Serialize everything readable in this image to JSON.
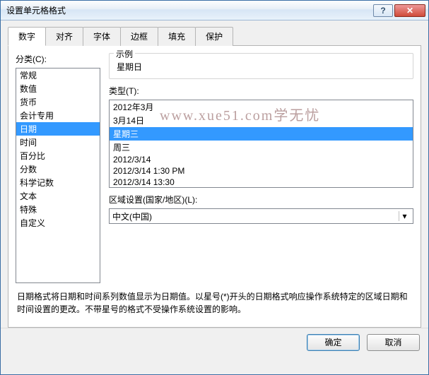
{
  "window": {
    "title": "设置单元格格式",
    "help_glyph": "?",
    "close_glyph": "✕"
  },
  "tabs": [
    "数字",
    "对齐",
    "字体",
    "边框",
    "填充",
    "保护"
  ],
  "active_tab_index": 0,
  "category": {
    "label": "分类(C):",
    "items": [
      "常规",
      "数值",
      "货币",
      "会计专用",
      "日期",
      "时间",
      "百分比",
      "分数",
      "科学记数",
      "文本",
      "特殊",
      "自定义"
    ],
    "selected_index": 4
  },
  "sample": {
    "legend": "示例",
    "value": "星期日"
  },
  "type": {
    "label": "类型(T):",
    "items": [
      "2012年3月",
      "3月14日",
      "星期三",
      "周三",
      "2012/3/14",
      "2012/3/14 1:30 PM",
      "2012/3/14 13:30"
    ],
    "selected_index": 2
  },
  "locale": {
    "label": "区域设置(国家/地区)(L):",
    "value": "中文(中国)",
    "arrow": "▾"
  },
  "description": "日期格式将日期和时间系列数值显示为日期值。以星号(*)开头的日期格式响应操作系统特定的区域日期和时间设置的更改。不带星号的格式不受操作系统设置的影响。",
  "footer": {
    "ok": "确定",
    "cancel": "取消"
  },
  "watermark": "www.xue51.com学无忧"
}
